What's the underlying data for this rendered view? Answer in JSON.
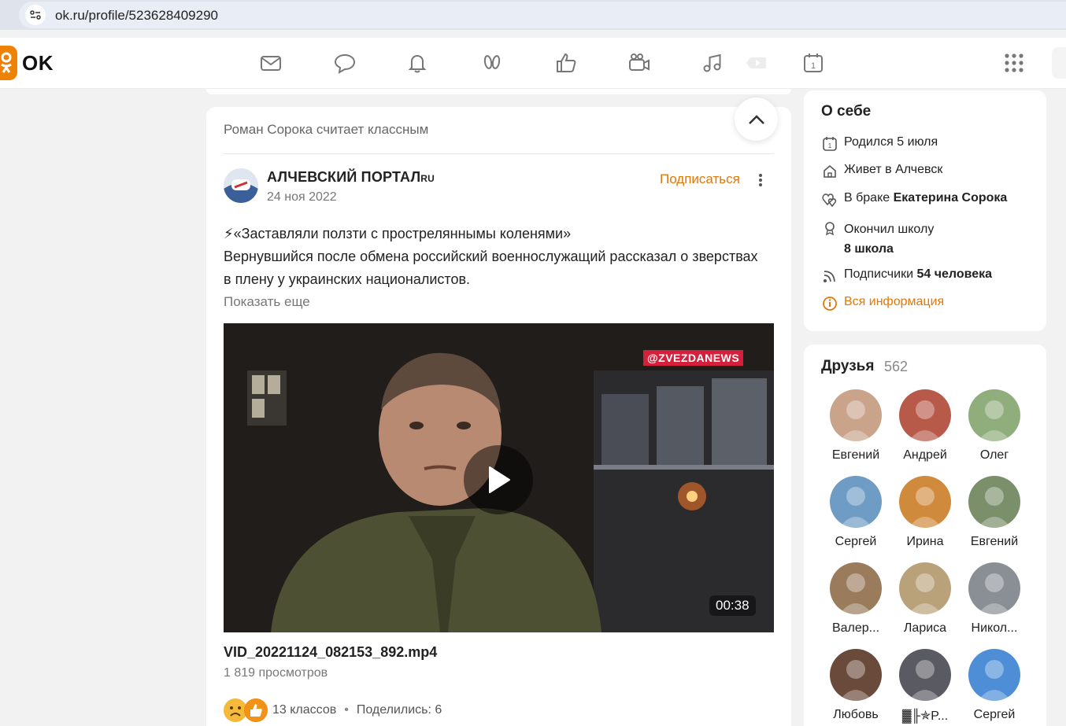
{
  "browser": {
    "url": "ok.ru/profile/523628409290"
  },
  "header": {
    "logo_text": "OK",
    "nav_icons": [
      "mail-icon",
      "chat-icon",
      "bell-icon",
      "guests-icon",
      "like-icon",
      "video-icon",
      "music-icon",
      "video-play-icon",
      "calendar-icon",
      "apps-grid-icon"
    ]
  },
  "post": {
    "liker_text": "Роман Сорока считает классным",
    "group_name": "АЛЧЕВСКИЙ ПОРТАЛ",
    "group_name_suffix": "RU",
    "date": "24 ноя 2022",
    "subscribe_label": "Подписаться",
    "headline": "⚡«Заставляли ползти с простреляннымы коленями»",
    "body": "Вернувшийся после обмена российский военнослужащий рассказал о зверствах в плену у украинских националистов.",
    "show_more": "Показать еще",
    "video": {
      "watermark": "@ZVEZDANEWS",
      "duration": "00:38"
    },
    "filename": "VID_20221124_082153_892.mp4",
    "views": "1 819 просмотров",
    "likes": "13 классов",
    "dot": "•",
    "shares": "Поделились: 6"
  },
  "about": {
    "title": "О себе",
    "born": "Родился 5 июля",
    "lives": "Живет в Алчевск",
    "married_prefix": "В браке ",
    "married_name": "Екатерина Сорока",
    "school_prefix": "Окончил школу",
    "school_name": "8 школа",
    "subscribers_prefix": "Подписчики ",
    "subscribers_count": "54 человека",
    "all_info": "Вся информация"
  },
  "friends": {
    "title": "Друзья",
    "count": "562",
    "list": [
      {
        "name": "Евгений",
        "color": "#c9a48a"
      },
      {
        "name": "Андрей",
        "color": "#b85a4a"
      },
      {
        "name": "Олег",
        "color": "#8fae7c"
      },
      {
        "name": "Сергей",
        "color": "#6f9cc4"
      },
      {
        "name": "Ирина",
        "color": "#d08a3c"
      },
      {
        "name": "Евгений",
        "color": "#7a8f6a"
      },
      {
        "name": "Валер...",
        "color": "#9a7c5c"
      },
      {
        "name": "Лариса",
        "color": "#b9a27a"
      },
      {
        "name": "Никол...",
        "color": "#8a8f96"
      },
      {
        "name": "Любовь",
        "color": "#6a4a3a"
      },
      {
        "name": "▓╟✯P...",
        "color": "#5a5a62"
      },
      {
        "name": "Сергей",
        "color": "#4e8ed6"
      }
    ]
  }
}
